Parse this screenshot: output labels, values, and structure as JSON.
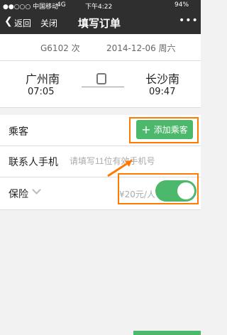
{
  "status_bar": {
    "carrier": "●●○○○ 中国移动",
    "network": "4G",
    "time": "下午4:22",
    "battery": "94%"
  },
  "nav": {
    "back": "返回",
    "close": "关闭",
    "title": "填写订单",
    "more": "•••"
  },
  "train_info": {
    "number": "G6102 次",
    "date": "2014-12-06 周六"
  },
  "route": {
    "from": "广州南",
    "depart_time": "07:05",
    "to": "长沙南",
    "arrive_time": "09:47"
  },
  "form": {
    "passenger_label": "乘客",
    "add_passenger": "添加乘客",
    "contact_label": "联系人手机",
    "contact_placeholder": "请填写11位有效手机号",
    "insurance_label": "保险",
    "insurance_price": "¥20元/人",
    "insurance_on": true
  },
  "colors": {
    "accent": "#4cb86b",
    "highlight": "#ff7a00",
    "bar": "#2f2f2f"
  }
}
